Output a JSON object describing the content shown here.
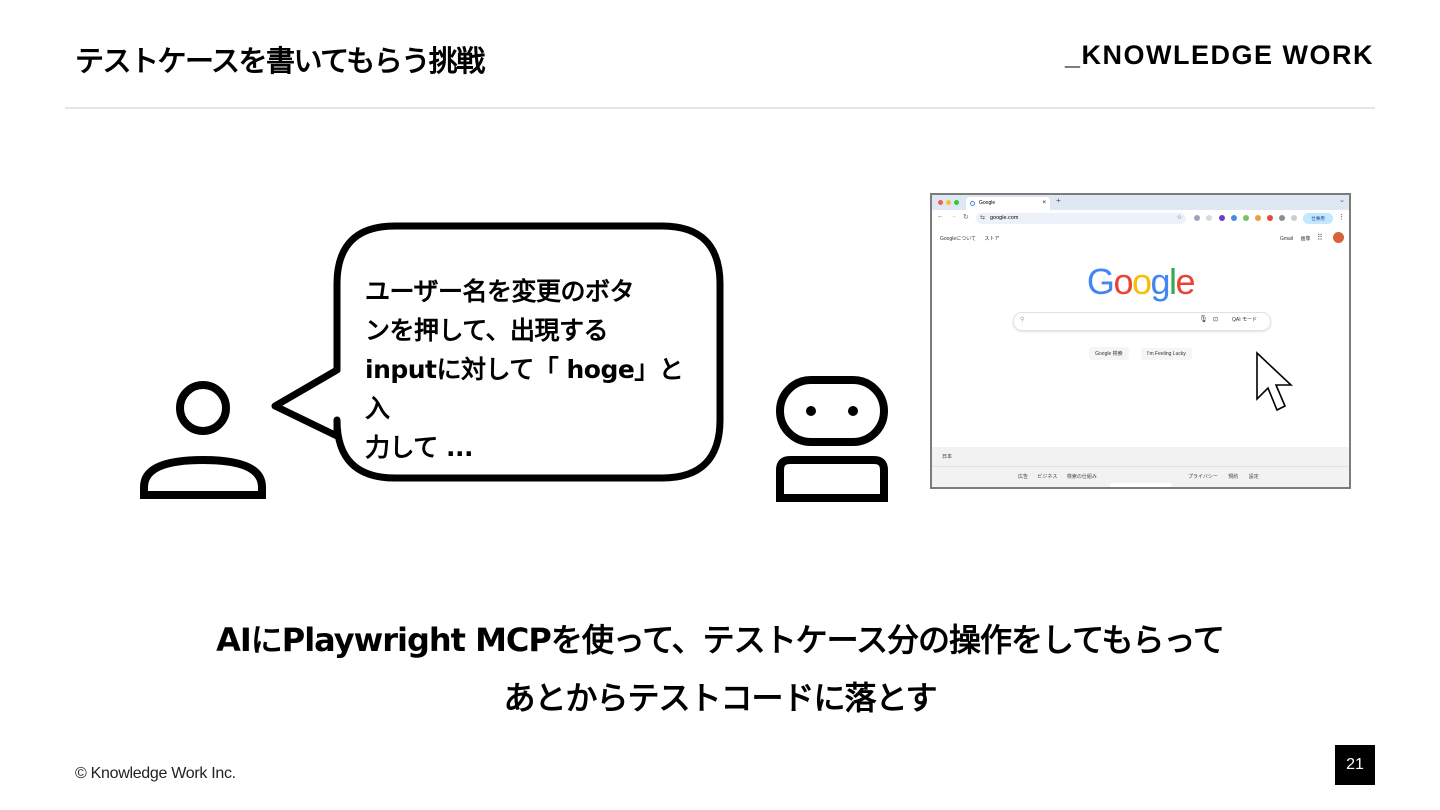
{
  "slide": {
    "title": "テストケースを書いてもらう挑戦",
    "brand": "_KNOWLEDGE WORK",
    "speech": {
      "lines": [
        "ユーザー名を変更のボタ",
        "ンを押して、出現する",
        "inputに対して「 hoge」と入",
        "力して ..."
      ]
    },
    "browser": {
      "tab_title": "Google",
      "tab_close": "×",
      "new_tab": "+",
      "url": "google.com",
      "profile_label": "仕事用",
      "top_links_left": [
        "Googleについて",
        "ストア"
      ],
      "top_links_right": [
        "Gmail",
        "画像"
      ],
      "logo_letters": [
        {
          "char": "G",
          "color": "#4285F4"
        },
        {
          "char": "o",
          "color": "#EA4335"
        },
        {
          "char": "o",
          "color": "#FBBC05"
        },
        {
          "char": "g",
          "color": "#4285F4"
        },
        {
          "char": "l",
          "color": "#34A853"
        },
        {
          "char": "e",
          "color": "#EA4335"
        }
      ],
      "ai_mode_label": "AI モード",
      "buttons": [
        "Google 検索",
        "I'm Feeling Lucky"
      ],
      "country": "日本",
      "footer_left": [
        "広告",
        "ビジネス",
        "検索の仕組み"
      ],
      "footer_right": [
        "プライバシー",
        "規約",
        "設定"
      ]
    },
    "caption_lines": [
      "AIにPlaywright MCPを使って、テストケース分の操作をしてもらって",
      "あとからテストコードに落とす"
    ],
    "copyright": "© Knowledge Work Inc.",
    "page_number": "21"
  }
}
